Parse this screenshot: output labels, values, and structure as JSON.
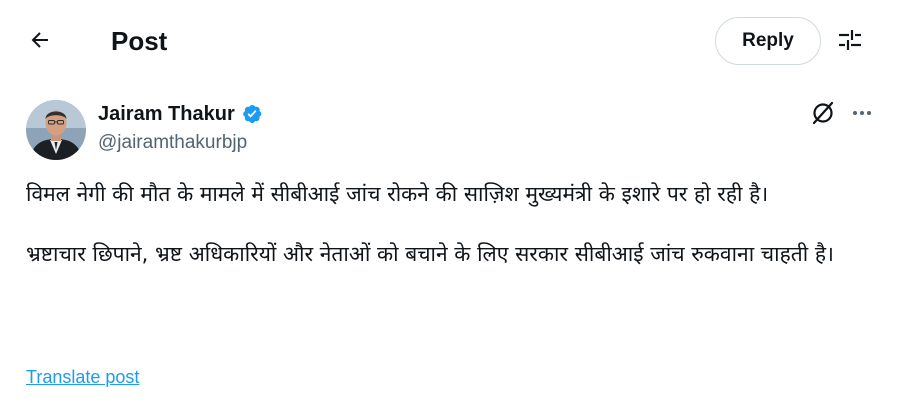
{
  "header": {
    "back_icon": "arrow-left-icon",
    "title": "Post",
    "reply_label": "Reply",
    "settings_icon": "sliders-icon"
  },
  "author": {
    "display_name": "Jairam Thakur",
    "handle": "@jairamthakurbjp",
    "verified_icon": "verified-badge-icon",
    "verified_color": "#1d9bf0"
  },
  "actions": {
    "grok_icon": "grok-icon",
    "more_icon": "more-horizontal-icon"
  },
  "post": {
    "paragraph1": "विमल नेगी की मौत के मामले में सीबीआई जांच रोकने की साज़िश मुख्यमंत्री के इशारे पर हो रही है।",
    "paragraph2": "भ्रष्टाचार छिपाने,  भ्रष्ट अधिकारियों और नेताओं को बचाने के लिए सरकार सीबीआई जांच रुकवाना चाहती है।",
    "translate_label": "Translate post"
  },
  "colors": {
    "text": "#0f1419",
    "secondary_text": "#536471",
    "link": "#1d9bf0",
    "border": "#cfd9de"
  }
}
